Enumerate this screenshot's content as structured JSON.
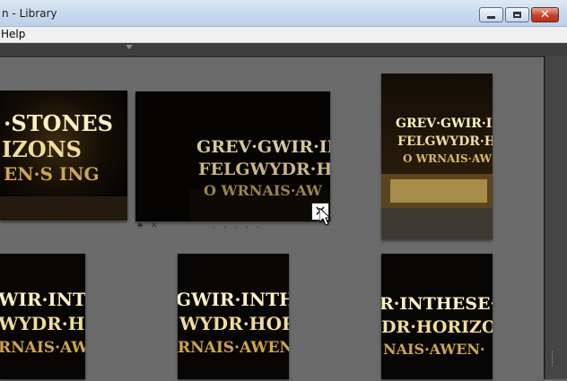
{
  "window": {
    "title": "n - Library",
    "buttons": {
      "minimize": "minimize",
      "maximize": "maximize",
      "close": "✕"
    }
  },
  "menubar": {
    "items": [
      "Help"
    ]
  },
  "grid": {
    "cells": [
      {
        "id": "cell-1",
        "lines": [
          "·STONES",
          "IZONS",
          "EN·S ING"
        ]
      },
      {
        "id": "cell-2",
        "lines": [
          "GREV·GWIR·INTH",
          "FELGWYDR·H",
          "O WRNAIS·AW"
        ]
      },
      {
        "id": "cell-3",
        "lines": [
          "GREV·GWIR·INTH",
          "FELGWYDR·H",
          "O WRNAIS·AW"
        ]
      },
      {
        "id": "cell-4",
        "lines": [
          "WIR·INTHESE",
          "WYDR·HOR",
          "RNAIS·AWE"
        ]
      },
      {
        "id": "cell-5",
        "lines": [
          "GWIR·INTHESE",
          "WYDR·HOR",
          "RNAIS·AWEN"
        ]
      },
      {
        "id": "cell-6",
        "lines": [
          "R·INTHESE·ST",
          "DR·HORIZO",
          "NAIS·AWEN·"
        ]
      }
    ],
    "cell_dots": "• • • • •",
    "remove_label": "✕"
  },
  "colors": {
    "text_glow": "#fff2c2",
    "text_dim": "#cfa64a"
  }
}
